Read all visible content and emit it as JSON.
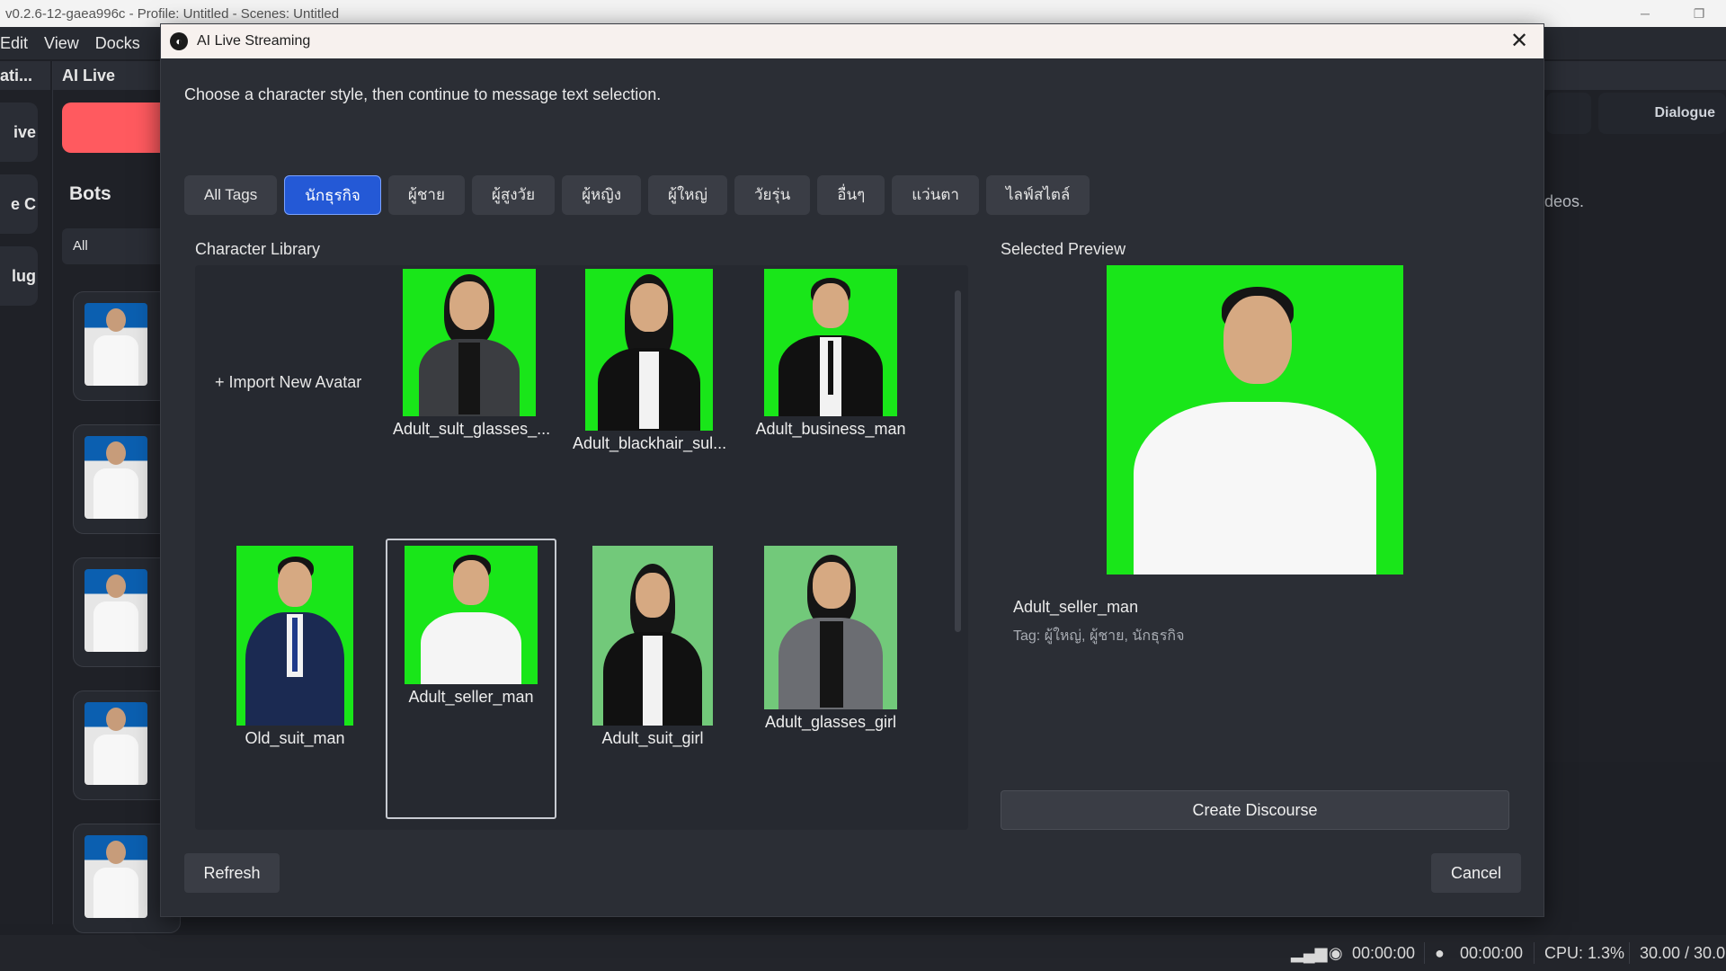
{
  "app": {
    "title": "v0.2.6-12-gaea996c - Profile: Untitled - Scenes: Untitled",
    "menu": [
      "Edit",
      "View",
      "Docks"
    ],
    "dock_headers": [
      "ati...",
      "AI Live"
    ],
    "side_tabs": [
      "ive",
      "e C",
      "lug"
    ],
    "bots_title": "Bots",
    "bots_filter": "All",
    "right_tab": "Dialogue",
    "right_text": "deos."
  },
  "status": {
    "rec_time_1": "00:00:00",
    "rec_time_2": "00:00:00",
    "cpu": "CPU: 1.3%",
    "fps": "30.00 / 30.0"
  },
  "dialog": {
    "title": "AI Live Streaming",
    "intro": "Choose a character style, then continue to message text selection.",
    "tags": [
      "All Tags",
      "นักธุรกิจ",
      "ผู้ชาย",
      "ผู้สูงวัย",
      "ผู้หญิง",
      "ผู้ใหญ่",
      "วัยรุ่น",
      "อื่นๆ",
      "แว่นตา",
      "ไลฟ์สไตล์"
    ],
    "active_tag": "นักธุรกิจ",
    "library_label": "Character Library",
    "preview_label": "Selected Preview",
    "import_label": "+ Import New Avatar",
    "characters": [
      {
        "name": "Adult_sult_glasses_..."
      },
      {
        "name": "Adult_blackhair_sul..."
      },
      {
        "name": "Adult_business_man"
      },
      {
        "name": "Old_suit_man"
      },
      {
        "name": "Adult_seller_man"
      },
      {
        "name": "Adult_suit_girl"
      },
      {
        "name": "Adult_glasses_girl"
      }
    ],
    "selected": {
      "name": "Adult_seller_man",
      "tags": "Tag: ผู้ใหญ่, ผู้ชาย, นักธุรกิจ"
    },
    "create_label": "Create Discourse",
    "refresh_label": "Refresh",
    "cancel_label": "Cancel"
  },
  "colors": {
    "accent": "#2459d6",
    "greenscreen": "#19e619",
    "record_red": "#ff5a5f"
  }
}
